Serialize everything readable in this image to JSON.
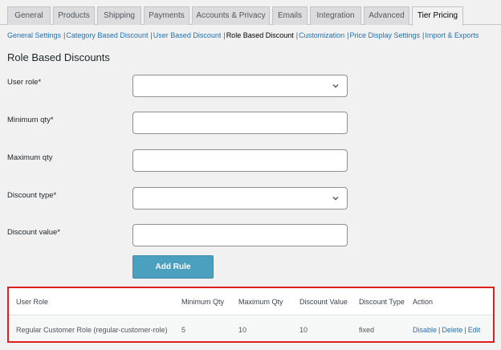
{
  "tabs": [
    {
      "label": "General"
    },
    {
      "label": "Products"
    },
    {
      "label": "Shipping"
    },
    {
      "label": "Payments"
    },
    {
      "label": "Accounts & Privacy"
    },
    {
      "label": "Emails"
    },
    {
      "label": "Integration"
    },
    {
      "label": "Advanced"
    },
    {
      "label": "Tier Pricing",
      "active": true
    }
  ],
  "subnav": [
    {
      "label": "General Settings"
    },
    {
      "label": "Category Based Discount"
    },
    {
      "label": "User Based Discount"
    },
    {
      "label": "Role Based Discount",
      "current": true
    },
    {
      "label": "Customization"
    },
    {
      "label": "Price Display Settings"
    },
    {
      "label": "Import & Exports"
    }
  ],
  "page_title": "Role Based Discounts",
  "form": {
    "user_role": {
      "label": "User role*",
      "value": ""
    },
    "min_qty": {
      "label": "Minimum qty*",
      "value": ""
    },
    "max_qty": {
      "label": "Maximum qty",
      "value": ""
    },
    "discount_type": {
      "label": "Discount type*",
      "value": ""
    },
    "discount_value": {
      "label": "Discount value*",
      "value": ""
    }
  },
  "add_rule_label": "Add Rule",
  "table": {
    "headers": [
      "User Role",
      "Minimum Qty",
      "Maximum Qty",
      "Discount Value",
      "Discount Type",
      "Action"
    ],
    "rows": [
      {
        "user_role": "Regular Customer Role (regular-customer-role)",
        "min_qty": "5",
        "max_qty": "10",
        "discount_value": "10",
        "discount_type": "fixed",
        "actions": [
          "Disable",
          "Delete",
          "Edit"
        ]
      }
    ]
  },
  "colors": {
    "accent": "#2271b1",
    "button": "#4ba0c0",
    "highlight_border": "#e02020"
  },
  "icons": {
    "select_arrow": "chevron-down-icon"
  }
}
